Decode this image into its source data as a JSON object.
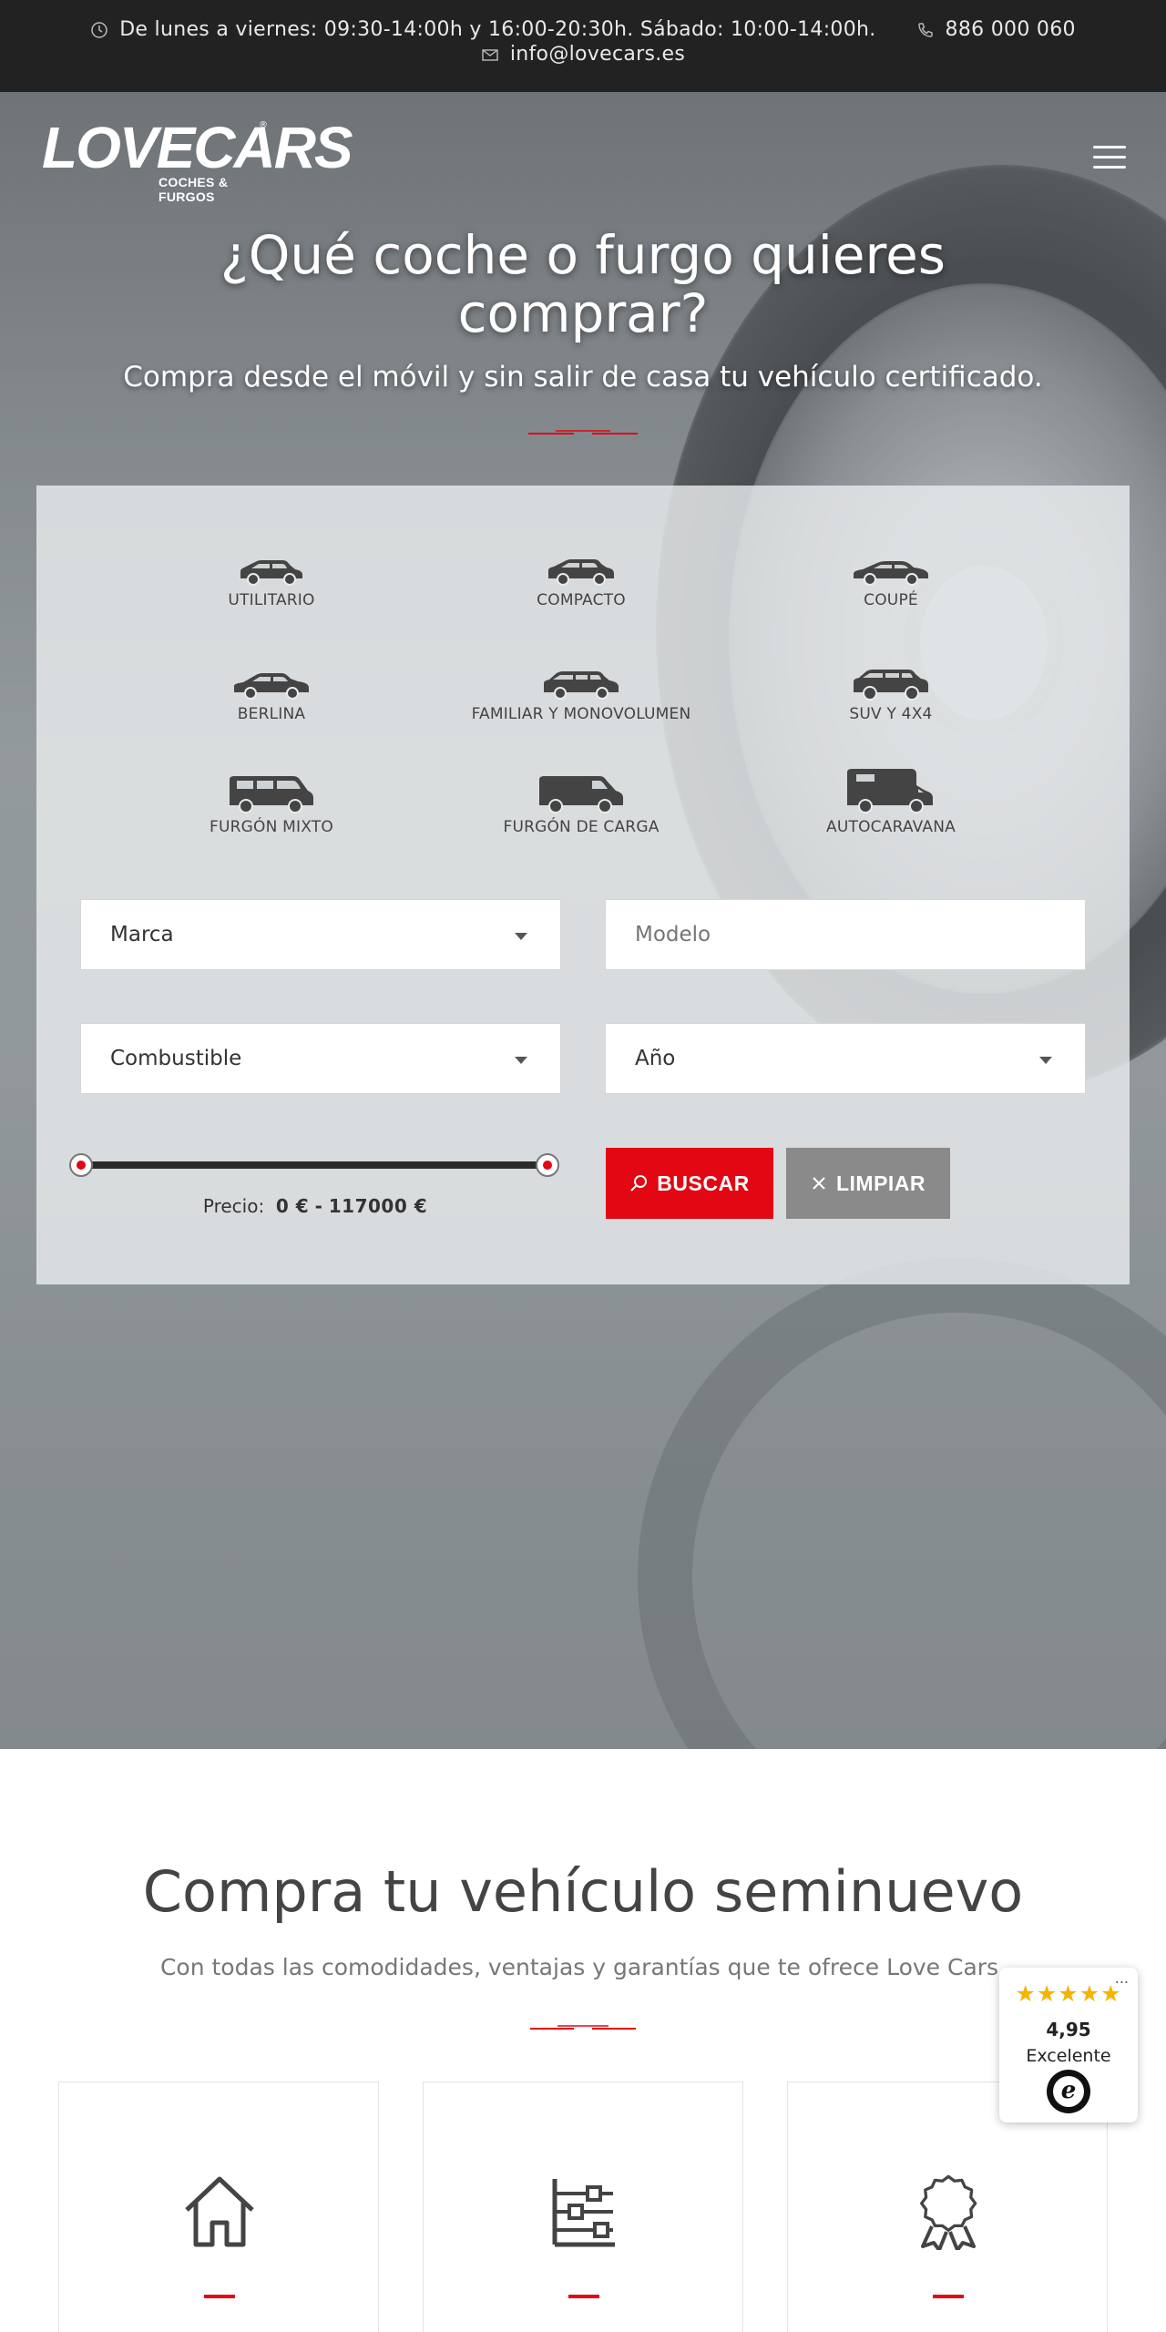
{
  "topbar": {
    "hours": "De lunes a viernes: 09:30-14:00h y 16:00-20:30h. Sábado: 10:00-14:00h.",
    "phone": "886 000 060",
    "email": "info@lovecars.es"
  },
  "logo": {
    "name": "LOVECARS",
    "tagline": "COCHES & FURGOS"
  },
  "hero": {
    "title": "¿Qué coche o furgo quieres comprar?",
    "subtitle": "Compra desde el móvil y sin salir de casa tu vehículo certificado."
  },
  "vehicle_types": [
    {
      "label": "UTILITARIO",
      "icon": "hatchback-car-icon"
    },
    {
      "label": "COMPACTO",
      "icon": "compact-car-icon"
    },
    {
      "label": "COUPÉ",
      "icon": "coupe-car-icon"
    },
    {
      "label": "BERLINA",
      "icon": "sedan-car-icon"
    },
    {
      "label": "FAMILIAR Y MONOVOLUMEN",
      "icon": "minivan-car-icon"
    },
    {
      "label": "SUV Y 4X4",
      "icon": "suv-car-icon"
    },
    {
      "label": "FURGÓN MIXTO",
      "icon": "mixed-van-icon"
    },
    {
      "label": "FURGÓN DE CARGA",
      "icon": "cargo-van-icon"
    },
    {
      "label": "AUTOCARAVANA",
      "icon": "motorhome-icon"
    }
  ],
  "filters": {
    "brand": "Marca",
    "model_placeholder": "Modelo",
    "fuel": "Combustible",
    "year": "Año"
  },
  "price": {
    "label": "Precio:",
    "min": "0 €",
    "separator": "-",
    "max": "117000 €"
  },
  "buttons": {
    "search": "BUSCAR",
    "clear": "LIMPIAR"
  },
  "section": {
    "title": "Compra tu vehículo seminuevo",
    "subtitle": "Con todas las comodidades, ventajas y garantías que te ofrece Love Cars."
  },
  "cards": [
    {
      "icon": "house-icon"
    },
    {
      "icon": "sliders-icon"
    },
    {
      "icon": "award-ribbon-icon"
    }
  ],
  "trust_badge": {
    "menu": "...",
    "stars": "★★★★★",
    "score": "4,95",
    "label": "Excelente",
    "logo_letter": "e"
  },
  "colors": {
    "accent": "#e30613",
    "topbar": "#222222",
    "clear_button": "#8a8a8a",
    "stars": "#f4b400"
  }
}
